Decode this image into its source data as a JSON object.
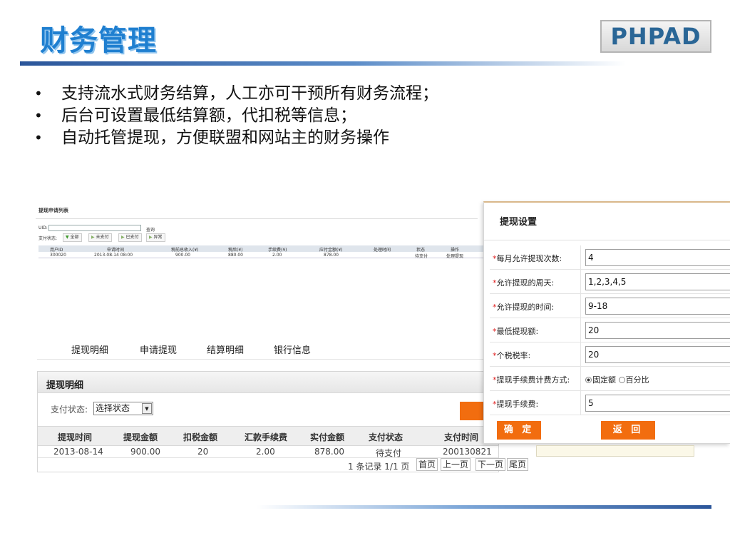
{
  "slide": {
    "title": "财务管理",
    "logo": "PHPAD",
    "bullets": [
      "支持流水式财务结算，人工亦可干预所有财务流程；",
      "后台可设置最低结算额，代扣税等信息；",
      "自动托管提现，方便联盟和网站主的财务操作"
    ]
  },
  "withdraw_list": {
    "title": "提现申请列表",
    "uid_label": "UID:",
    "uid_value": "",
    "query_label": "查询",
    "status_label": "支付状态:",
    "filters": [
      "全部",
      "未支付",
      "已支付",
      "异常"
    ],
    "columns": [
      "用户ID",
      "申请时间",
      "税前总收入(¥)",
      "税后(¥)",
      "手续费(¥)",
      "应付金额(¥)",
      "处理时间",
      "状态",
      "操作"
    ],
    "rows": [
      [
        "300020",
        "2013-08-14 08:00",
        "900.00",
        "880.00",
        "2.00",
        "878.00",
        "",
        "待支付",
        "处理提现"
      ]
    ]
  },
  "tabs": [
    "提现明细",
    "申请提现",
    "结算明细",
    "银行信息"
  ],
  "detail": {
    "title": "提现明细",
    "pay_status_label": "支付状态:",
    "pay_status_value": "选择状态",
    "columns": [
      "提现时间",
      "提现金额",
      "扣税金额",
      "汇款手续费",
      "实付金额",
      "支付状态",
      "支付时间"
    ],
    "rows": [
      [
        "2013-08-14",
        "900.00",
        "20",
        "2.00",
        "878.00",
        "待支付",
        "200130821"
      ]
    ],
    "pager": {
      "summary": "1 条记录 1/1 页",
      "first": "首页",
      "prev": "上一页",
      "next": "下一页",
      "last": "尾页"
    }
  },
  "settings": {
    "title": "提现设置",
    "fields": [
      {
        "label": "每月允许提现次数:",
        "value": "4"
      },
      {
        "label": "允许提现的周天:",
        "value": "1,2,3,4,5"
      },
      {
        "label": "允许提现的时间:",
        "value": "9-18"
      },
      {
        "label": "最低提现额:",
        "value": "20"
      },
      {
        "label": "个税税率:",
        "value": "20"
      },
      {
        "label": "提现手续费计费方式:",
        "options": [
          "固定额",
          "百分比"
        ],
        "selected": "固定额"
      },
      {
        "label": "提现手续费:",
        "value": "5"
      }
    ],
    "required_mark": "*",
    "confirm": "确 定",
    "back": "返 回"
  },
  "colors": {
    "title_blue": "#1f7fd0",
    "rule_blue": "#2b569a",
    "orange": "#f26d0f",
    "required_red": "#e02020"
  }
}
